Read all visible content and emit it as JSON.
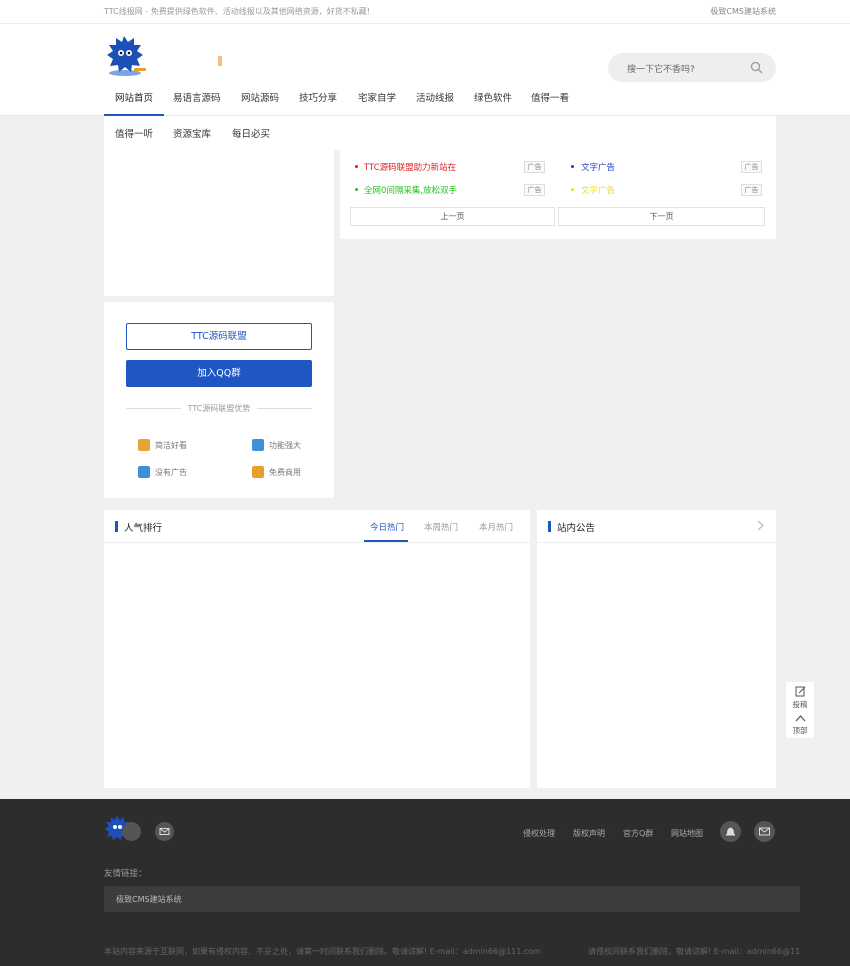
{
  "topbar": {
    "tagline": "TTC线报网 - 免费提供绿色软件、活动线报以及其他网络资源，好货不私藏!",
    "right_link": "极致CMS建站系统"
  },
  "search": {
    "placeholder": "搜一下它不香吗?"
  },
  "nav": {
    "row1": [
      "网站首页",
      "易语言源码",
      "网站源码",
      "技巧分享",
      "宅家自学",
      "活动线报",
      "绿色软件",
      "值得一看"
    ],
    "row2": [
      "值得一听",
      "资源宝库",
      "每日必买"
    ]
  },
  "ads": {
    "items": [
      {
        "text": "TTC源码联盟助力新站在",
        "color": "#e02020",
        "tag": "广告"
      },
      {
        "text": "文字广告",
        "color": "#1e3fd0",
        "tag": "广告"
      },
      {
        "text": "全网0间隔采集,放松双手",
        "color": "#22c422",
        "tag": "广告"
      },
      {
        "text": "文字广告",
        "color": "#e8e020",
        "tag": "广告"
      }
    ],
    "prev": "上一页",
    "next": "下一页"
  },
  "union": {
    "btn_outline": "TTC源码联盟",
    "btn_fill": "加入QQ群",
    "divider": "TTC源码联盟优势",
    "features": [
      {
        "label": "简洁好看",
        "icon": "envelope-icon",
        "color": "#e9a534"
      },
      {
        "label": "功能强大",
        "icon": "document-icon",
        "color": "#3e8fd6"
      },
      {
        "label": "没有广告",
        "icon": "ad-icon",
        "color": "#3d8fd8"
      },
      {
        "label": "免费商用",
        "icon": "laptop-icon",
        "color": "#e8a02c"
      }
    ]
  },
  "ranking": {
    "title": "人气排行",
    "tabs": [
      "今日热门",
      "本周热门",
      "本月热门"
    ]
  },
  "notice": {
    "title": "站内公告"
  },
  "side": {
    "submit": "投稿",
    "top": "顶部"
  },
  "footer": {
    "links": [
      "侵权处理",
      "版权声明",
      "官方Q群",
      "网站地图"
    ],
    "friend_title": "友情链接：",
    "friend_link": "极致CMS建站系统",
    "bottom_left": "本站内容来源于互联网，如果有侵权内容、不妥之处，请第一时间联系我们删除。敬请谅解! E-mail：admin66@111.com",
    "bottom_right": "请侵权间联系我们删除。敬请谅解! E-mail：admin66@11"
  },
  "colors": {
    "accent": "#1e56c2",
    "footer_bg": "#2d2d2d",
    "page_bg": "#f0f0f0"
  }
}
